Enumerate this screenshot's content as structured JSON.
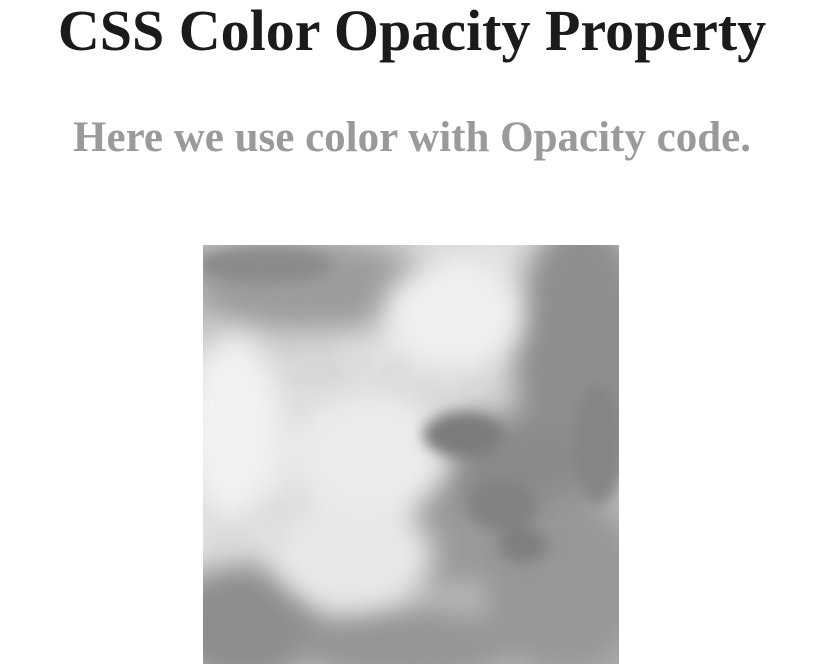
{
  "page": {
    "title": "CSS Color Opacity Property",
    "subtitle": "Here we use color with Opacity code.",
    "title_color": "#1b1b1b",
    "subtitle_color": "#9a9a9c"
  },
  "image": {
    "subject": "cloudy sky photo (grayscale)"
  }
}
